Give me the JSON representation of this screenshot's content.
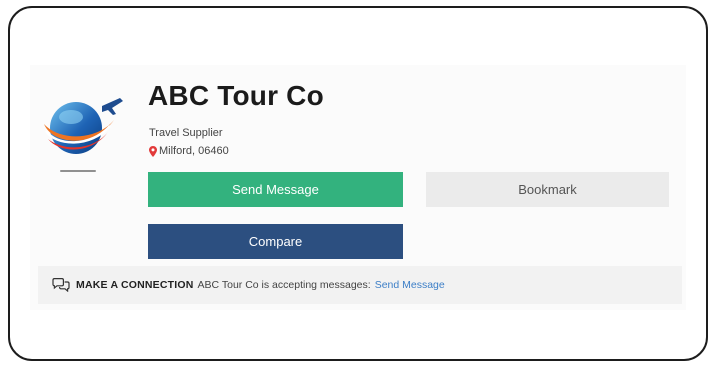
{
  "supplier": {
    "name": "ABC Tour Co",
    "type": "Travel Supplier",
    "location": "Milford, 06460"
  },
  "actions": {
    "send_message": "Send Message",
    "bookmark": "Bookmark",
    "compare": "Compare"
  },
  "connection": {
    "heading": "MAKE A CONNECTION",
    "message": "ABC Tour Co is accepting messages:",
    "link": "Send Message"
  },
  "icons": {
    "logo": "globe-plane-logo",
    "location": "map-pin-icon",
    "connection": "chat-bubbles-icon"
  },
  "colors": {
    "send_button": "#33b27e",
    "compare_button": "#2c4f80",
    "bookmark_button": "#ebebeb",
    "link": "#3d7fc7",
    "pin": "#e23a3a"
  }
}
